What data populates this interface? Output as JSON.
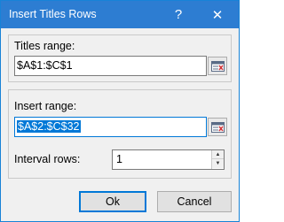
{
  "window": {
    "title": "Insert Titles Rows",
    "help_glyph": "?",
    "close_glyph": "✕"
  },
  "titles_range": {
    "label": "Titles range:",
    "value": "$A$1:$C$1"
  },
  "insert_range": {
    "label": "Insert range:",
    "value": "$A$2:$C$32"
  },
  "interval_rows": {
    "label": "Interval rows:",
    "value": "1"
  },
  "buttons": {
    "ok_label": "Ok",
    "cancel_label": "Cancel"
  },
  "icons": {
    "range_select": "range-select-icon",
    "spin_up": "chevron-up-icon",
    "spin_down": "chevron-down-icon"
  },
  "colors": {
    "titlebar": "#2d7dd2",
    "selection": "#0078d7"
  }
}
